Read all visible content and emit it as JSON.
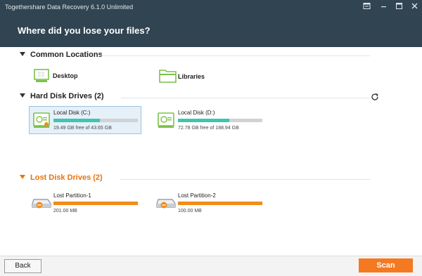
{
  "app": {
    "title": "Togethershare Data Recovery 6.1.0 Unlimited"
  },
  "header": {
    "question": "Where did you lose your files?"
  },
  "sections": {
    "common": {
      "title": "Common Locations",
      "items": [
        {
          "label": "Desktop",
          "icon": "desktop-icon"
        },
        {
          "label": "Libraries",
          "icon": "folder-icon"
        }
      ]
    },
    "hdd": {
      "title": "Hard Disk Drives (2)",
      "drives": [
        {
          "name": "Local Disk (C:)",
          "size": "19.49 GB free of 43.65 GB",
          "used_fraction": 0.55,
          "selected": true
        },
        {
          "name": "Local Disk (D:)",
          "size": "72.78 GB free of 188.94 GB",
          "used_fraction": 0.61,
          "selected": false
        }
      ]
    },
    "lost": {
      "title": "Lost Disk Drives (2)",
      "drives": [
        {
          "name": "Lost Partition-1",
          "size": "201.00 MB",
          "used_fraction": 1.0
        },
        {
          "name": "Lost Partition-2",
          "size": "100.00 MB",
          "used_fraction": 1.0
        }
      ]
    }
  },
  "footer": {
    "back_label": "Back",
    "scan_label": "Scan"
  },
  "colors": {
    "titlebar": "#314452",
    "accent_orange": "#f57920",
    "teal_fill": "#41c4b0",
    "lost_heading": "#e8720c"
  }
}
